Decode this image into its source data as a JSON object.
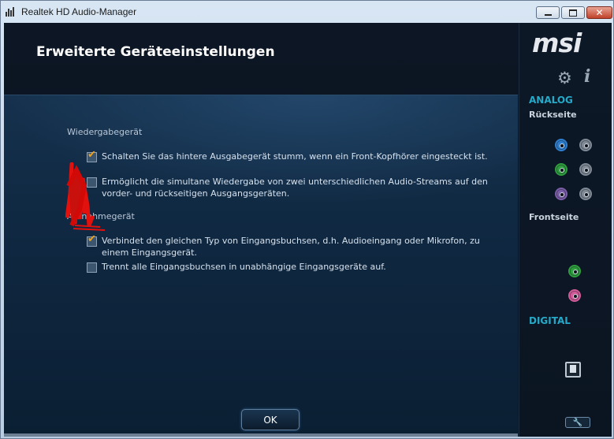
{
  "window": {
    "title": "Realtek HD Audio-Manager",
    "close_glyph": "✕"
  },
  "header": {
    "title": "Erweiterte Geräteeinstellungen"
  },
  "playback": {
    "section_title": "Wiedergabegerät",
    "options": [
      {
        "label": "Schalten Sie das hintere Ausgabegerät stumm, wenn ein Front-Kopfhörer eingesteckt ist.",
        "checked": true
      },
      {
        "label": "Ermöglicht die simultane Wiedergabe von zwei unterschiedlichen Audio-Streams auf den vorder- und rückseitigen Ausgangsgeräten.",
        "checked": false
      }
    ]
  },
  "recording": {
    "section_title": "Aufnahmegerät",
    "options": [
      {
        "label": "Verbindet den gleichen Typ von Eingangsbuchsen, d.h. Audioeingang oder Mikrofon, zu einem Eingangsgerät.",
        "checked": true
      },
      {
        "label": "Trennt alle Eingangsbuchsen in unabhängige Eingangsgeräte auf.",
        "checked": false
      }
    ]
  },
  "ok_button": "OK",
  "sidebar": {
    "logo": "msi",
    "settings_icon": "gear-icon",
    "info_icon": "info-icon",
    "info_glyph": "i",
    "analog_label": "ANALOG",
    "rear_label": "Rückseite",
    "front_label": "Frontseite",
    "digital_label": "DIGITAL",
    "rear_jacks": [
      "blue",
      "gray",
      "green",
      "gray",
      "purple",
      "gray"
    ],
    "front_jacks": [
      "green",
      "pink"
    ]
  },
  "colors": {
    "accent_cyan": "#26a9c8",
    "check_orange": "#f0a21c",
    "jack_blue": "#2e7fd0",
    "jack_green": "#2f9e3e",
    "jack_purple": "#7b5ea8",
    "jack_pink": "#d45b9a",
    "jack_gray": "#7f8a96"
  }
}
